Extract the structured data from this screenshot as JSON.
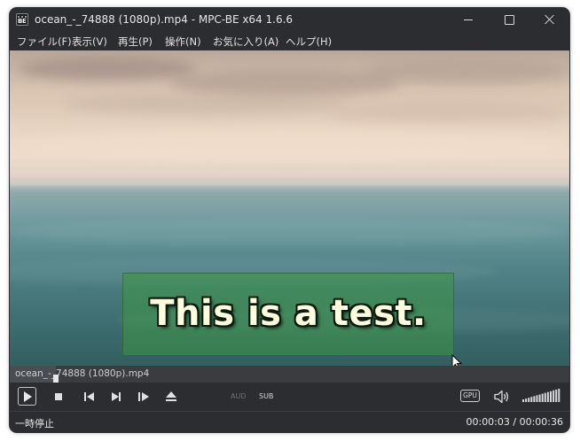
{
  "window": {
    "title": "ocean_-_74888 (1080p).mp4 - MPC-BE x64 1.6.6",
    "app_icon_text": "BE"
  },
  "menu": {
    "items": [
      {
        "label": "ファイル(F)"
      },
      {
        "label": "表示(V)"
      },
      {
        "label": "再生(P)"
      },
      {
        "label": "操作(N)"
      },
      {
        "label": "お気に入り(A)"
      },
      {
        "label": "ヘルプ(H)"
      }
    ]
  },
  "video": {
    "subtitle": "This is a test."
  },
  "seekbar": {
    "filename": "ocean_-_74888 (1080p).mp4",
    "progress_fraction": 0.083
  },
  "controls": {
    "play_icon": "play-icon",
    "stop_icon": "stop-icon",
    "prev_icon": "skip-previous-icon",
    "next_icon": "skip-next-icon",
    "frame_step_icon": "frame-step-icon",
    "eject_icon": "eject-icon",
    "audio_label": "AUD",
    "subtitle_label": "SUB",
    "gpu_label": "GPU",
    "speaker_icon": "speaker-icon",
    "volume_fraction": 1.0
  },
  "status": {
    "state": "一時停止",
    "current_time": "00:00:03",
    "separator": " / ",
    "duration": "00:00:36"
  },
  "colors": {
    "chrome_background": "#2b2d31",
    "seekbar_background": "#3a3c40",
    "subtitle_box": "#3c9646",
    "subtitle_text": "#fffde0"
  }
}
